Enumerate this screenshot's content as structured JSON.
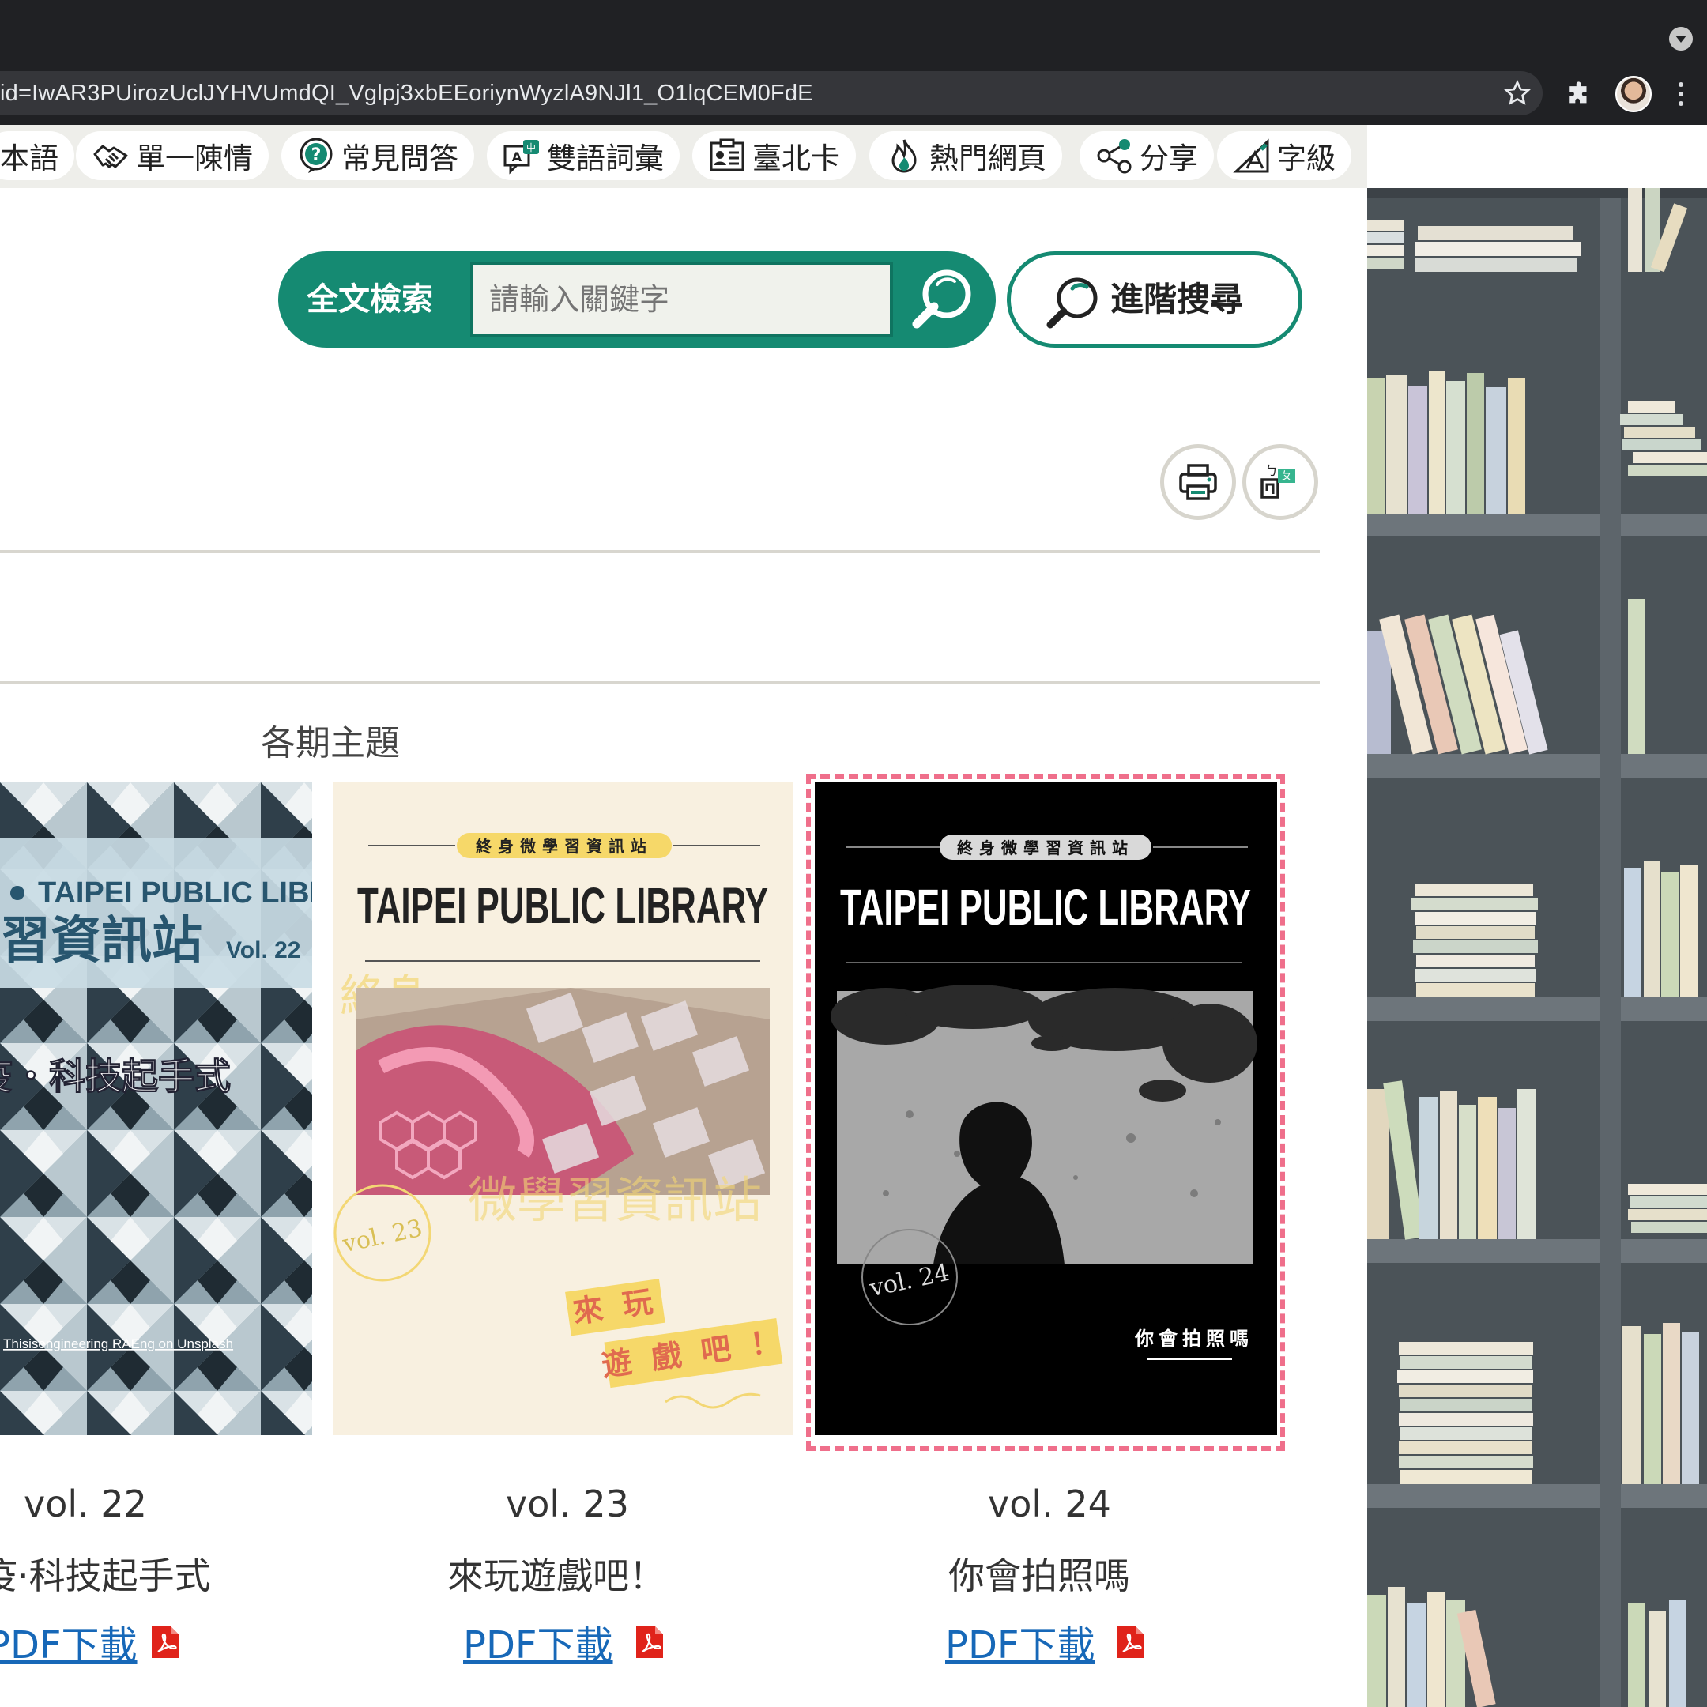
{
  "browser": {
    "url": "id=IwAR3PUirozUclJYHVUmdQI_Vglpj3xbEEoriynWyzlA9NJl1_O1lqCEM0FdE",
    "icons": [
      "tab-dropdown-icon",
      "bookmark-star-icon",
      "extensions-puzzle-icon",
      "profile-avatar",
      "menu-kebab-icon"
    ]
  },
  "nav": {
    "items": [
      {
        "label": "本語",
        "icon": "language-icon"
      },
      {
        "label": "單一陳情",
        "icon": "handshake-icon"
      },
      {
        "label": "常見問答",
        "icon": "question-icon"
      },
      {
        "label": "雙語詞彙",
        "icon": "bilingual-icon"
      },
      {
        "label": "臺北卡",
        "icon": "card-icon"
      },
      {
        "label": "熱門網頁",
        "icon": "fire-icon"
      },
      {
        "label": "分享",
        "icon": "share-icon"
      },
      {
        "label": "字級",
        "icon": "font-size-icon"
      }
    ]
  },
  "search": {
    "label": "全文檢索",
    "placeholder": "請輸入關鍵字",
    "advanced_label": "進階搜尋"
  },
  "section": {
    "title": "各期主題"
  },
  "issues": [
    {
      "vol": "vol. 22",
      "title": "疫·科技起手式",
      "pdf": "PDF下載",
      "cover": {
        "brand": "TAIPEI PUBLIC LIBRARY",
        "name": "習資訊站",
        "vol": "Vol. 22",
        "subtitle": "疫・科技起手式",
        "credit": "Thisisengineering RAEng on Unsplash"
      }
    },
    {
      "vol": "vol. 23",
      "title": "來玩遊戲吧！",
      "pdf": "PDF下載",
      "cover": {
        "series": "終身微學習資訊站",
        "brand": "TAIPEI PUBLIC LIBRARY",
        "vol": "vol. 23",
        "watermark_top": "終身",
        "watermark": "微學習資訊站",
        "tag1": "來 玩",
        "tag2": "遊 戲 吧 ！"
      }
    },
    {
      "vol": "vol. 24",
      "title": "你會拍照嗎",
      "pdf": "PDF下載",
      "cover": {
        "series": "終身微學習資訊站",
        "brand": "TAIPEI PUBLIC LIBRARY",
        "vol": "vol. 24",
        "subtitle": "你會拍照嗎"
      }
    }
  ],
  "tools": {
    "icons": [
      "print-icon",
      "zhuyin-icon"
    ]
  },
  "colors": {
    "brand_green": "#158a72",
    "focus_ring": "#ef6f8b",
    "link_blue": "#1768b8"
  }
}
